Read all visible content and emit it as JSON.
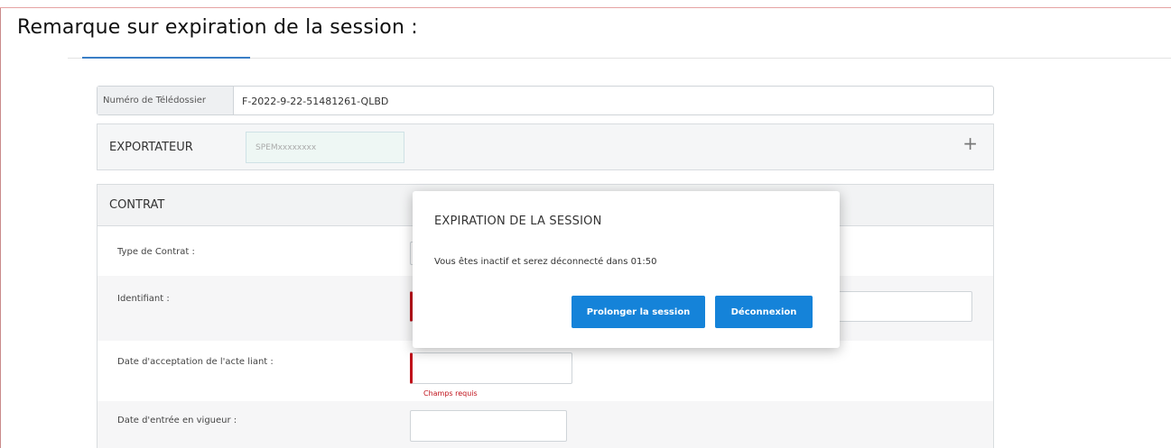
{
  "remark": {
    "title": "Remarque sur expiration de la session :"
  },
  "file": {
    "label": "Numéro de Télédossier",
    "value": "F-2022-9-22-51481261-QLBD"
  },
  "exportateur": {
    "label": "EXPORTATEUR",
    "input_value": "SPEMxxxxxxxx",
    "add_icon": "plus-icon"
  },
  "contrat": {
    "title": "CONTRAT",
    "fields": {
      "type": "Type de Contrat :",
      "identifiant": "Identifiant :",
      "date_acceptation": "Date d'acceptation de l'acte liant :",
      "date_acceptation_error": "Champs requis",
      "date_entree": "Date d'entrée en vigueur :"
    }
  },
  "modal": {
    "title": "EXPIRATION DE LA SESSION",
    "message": "Vous êtes inactif et serez déconnecté dans 01:50",
    "extend_label": "Prolonger la session",
    "logout_label": "Déconnexion"
  },
  "colors": {
    "primary_button": "#1583d9",
    "error": "#c0121b",
    "tab_accent": "#3a7ec6"
  }
}
